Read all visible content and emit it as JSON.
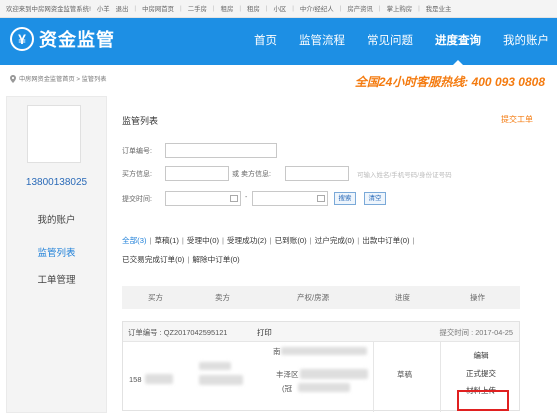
{
  "topbar": {
    "welcome": "欢迎来到中房网资金监管系统!",
    "user": "小羊",
    "logout": "退出",
    "links": [
      "中房网首页",
      "二手房",
      "租房",
      "租房",
      "小区",
      "中介/经纪人",
      "房产资讯",
      "掌上购房",
      "我是业主"
    ]
  },
  "brand": {
    "logo_symbol": "¥",
    "name": "资金监管"
  },
  "nav": {
    "items": [
      {
        "label": "首页"
      },
      {
        "label": "监管流程"
      },
      {
        "label": "常见问题"
      },
      {
        "label": "进度查询"
      },
      {
        "label": "我的账户"
      }
    ]
  },
  "breadcrumb": {
    "text": "中房网资金监管首页 > 监管列表"
  },
  "hotline": {
    "text": "全国24小时客服热线: 400 093 0808"
  },
  "sidebar": {
    "phone": "13800138025",
    "items": [
      {
        "label": "我的账户"
      },
      {
        "label": "监管列表"
      },
      {
        "label": "工单管理"
      }
    ]
  },
  "main": {
    "title": "监管列表",
    "submit_ticket": "提交工单",
    "search": {
      "order_no_label": "订单编号:",
      "buyer_label": "买方信息:",
      "or_seller_label": "或 卖方信息:",
      "contact_hint": "可输入姓名/手机号码/身份证号码",
      "submit_time_label": "提交时间:",
      "range_dash": "-",
      "search_button": "搜索",
      "clear_button": "清空"
    },
    "filters": [
      {
        "label": "全部(3)"
      },
      {
        "label": "草稿(1)"
      },
      {
        "label": "受理中(0)"
      },
      {
        "label": "受理成功(2)"
      },
      {
        "label": "已到账(0)"
      },
      {
        "label": "过户完成(0)"
      },
      {
        "label": "出款中订单(0)"
      },
      {
        "label": "已交易完成订单(0)"
      },
      {
        "label": "解除中订单(0)"
      }
    ],
    "table_headers": [
      "买方",
      "卖方",
      "产权/房源",
      "进度",
      "操作"
    ],
    "order": {
      "number": "订单编号 : QZ2017042595121",
      "print": "打印",
      "submit_time": "提交时间 : 2017-04-25",
      "buyer_phone_partial": "158",
      "property_line_top": "南",
      "property_district": "丰泽区",
      "property_suffix": "(冠",
      "status": "草稿",
      "ops": {
        "edit": "编辑",
        "formal_submit": "正式提交",
        "upload": "材料上传"
      }
    }
  }
}
